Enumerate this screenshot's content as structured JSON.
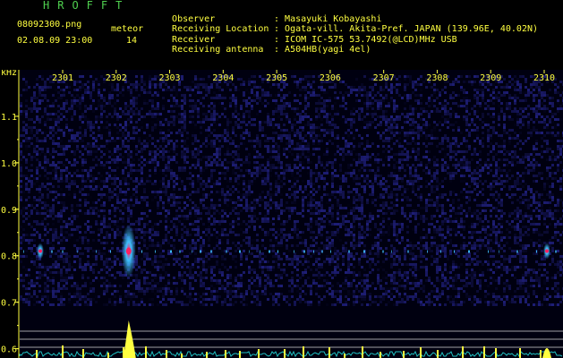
{
  "header": {
    "logo": "HROFFT",
    "filename": "08092300.png",
    "datetime": "02.08.09 23:00",
    "meteor_label": "meteor",
    "meteor_count": "14"
  },
  "info": [
    {
      "key": "Observer",
      "sep": ":",
      "value": "Masayuki Kobayashi"
    },
    {
      "key": "Receiving Location",
      "sep": ":",
      "value": "Ogata-vill. Akita-Pref. JAPAN (139.96E, 40.02N)"
    },
    {
      "key": "Receiver",
      "sep": ":",
      "value": "ICOM IC-575 53.7492(@LCD)MHz USB"
    },
    {
      "key": "Receiving antenna",
      "sep": ":",
      "value": "A504HB(yagi 4el)"
    }
  ],
  "chart_data": {
    "type": "heatmap",
    "ylabel": "kHz",
    "x_ticks": [
      "2301",
      "2302",
      "2303",
      "2304",
      "2305",
      "2306",
      "2307",
      "2308",
      "2309",
      "2310"
    ],
    "y_ticks": [
      "1.1",
      "1.0",
      "0.9",
      "0.8",
      "0.7",
      "0.6"
    ],
    "ylim": [
      0.58,
      1.2
    ],
    "echo_frequency_khz": 0.81,
    "bright_echo_minutes": [
      "2301",
      "2302",
      "2310"
    ],
    "colors": {
      "background": "#000010",
      "noise": "#2a2aa0",
      "axis": "#ffff40",
      "echo_core": "#ff2060",
      "echo_halo": "#40c0ff",
      "level_bars": "#ffff40",
      "level_trace": "#20c0c0"
    }
  }
}
